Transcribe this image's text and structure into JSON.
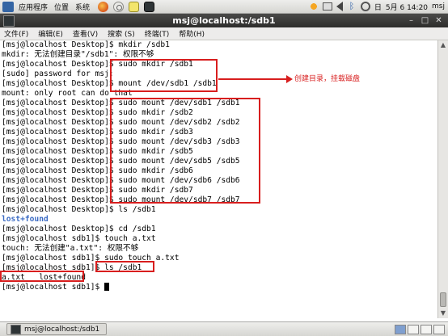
{
  "top_panel": {
    "menus": [
      "应用程序",
      "位置",
      "系统"
    ],
    "tray_label": "日",
    "clock": "5月  6 14:20",
    "user": "msj"
  },
  "window": {
    "title": "msj@localhost:/sdb1"
  },
  "menubar": {
    "items": [
      "文件(F)",
      "编辑(E)",
      "查看(V)",
      "搜索 (S)",
      "终端(T)",
      "帮助(H)"
    ]
  },
  "terminal": {
    "lines": [
      "[msj@localhost Desktop]$ mkdir /sdb1",
      "mkdir: 无法创建目录\"/sdb1\": 权限不够",
      "[msj@localhost Desktop]$ sudo mkdir /sdb1",
      "[sudo] password for msj:",
      "[msj@localhost Desktop]$ mount /dev/sdb1 /sdb1",
      "mount: only root can do that",
      "[msj@localhost Desktop]$ sudo mount /dev/sdb1 /sdb1",
      "[msj@localhost Desktop]$ sudo mkdir /sdb2",
      "[msj@localhost Desktop]$ sudo mount /dev/sdb2 /sdb2",
      "[msj@localhost Desktop]$ sudo mkdir /sdb3",
      "[msj@localhost Desktop]$ sudo mount /dev/sdb3 /sdb3",
      "[msj@localhost Desktop]$ sudo mkdir /sdb5",
      "[msj@localhost Desktop]$ sudo mount /dev/sdb5 /sdb5",
      "[msj@localhost Desktop]$ sudo mkdir /sdb6",
      "[msj@localhost Desktop]$ sudo mount /dev/sdb6 /sdb6",
      "[msj@localhost Desktop]$ sudo mkdir /sdb7",
      "[msj@localhost Desktop]$ sudo mount /dev/sdb7 /sdb7",
      "[msj@localhost Desktop]$ ls /sdb1",
      "lost+found",
      "[msj@localhost Desktop]$ cd /sdb1",
      "[msj@localhost sdb1]$ touch a.txt",
      "touch: 无法创建\"a.txt\": 权限不够",
      "[msj@localhost sdb1]$ sudo touch a.txt",
      "[msj@localhost sdb1]$ ls /sdb1",
      "a.txt   lost+found",
      "[msj@localhost sdb1]$ "
    ],
    "annotation": "创建目录，挂载磁盘"
  },
  "taskbar": {
    "task_label": "msj@localhost:/sdb1"
  },
  "colors": {
    "annotation_red": "#d81e1e",
    "directory_blue": "#3b6bc4",
    "titlebar_dark": "#2d2d2b"
  }
}
